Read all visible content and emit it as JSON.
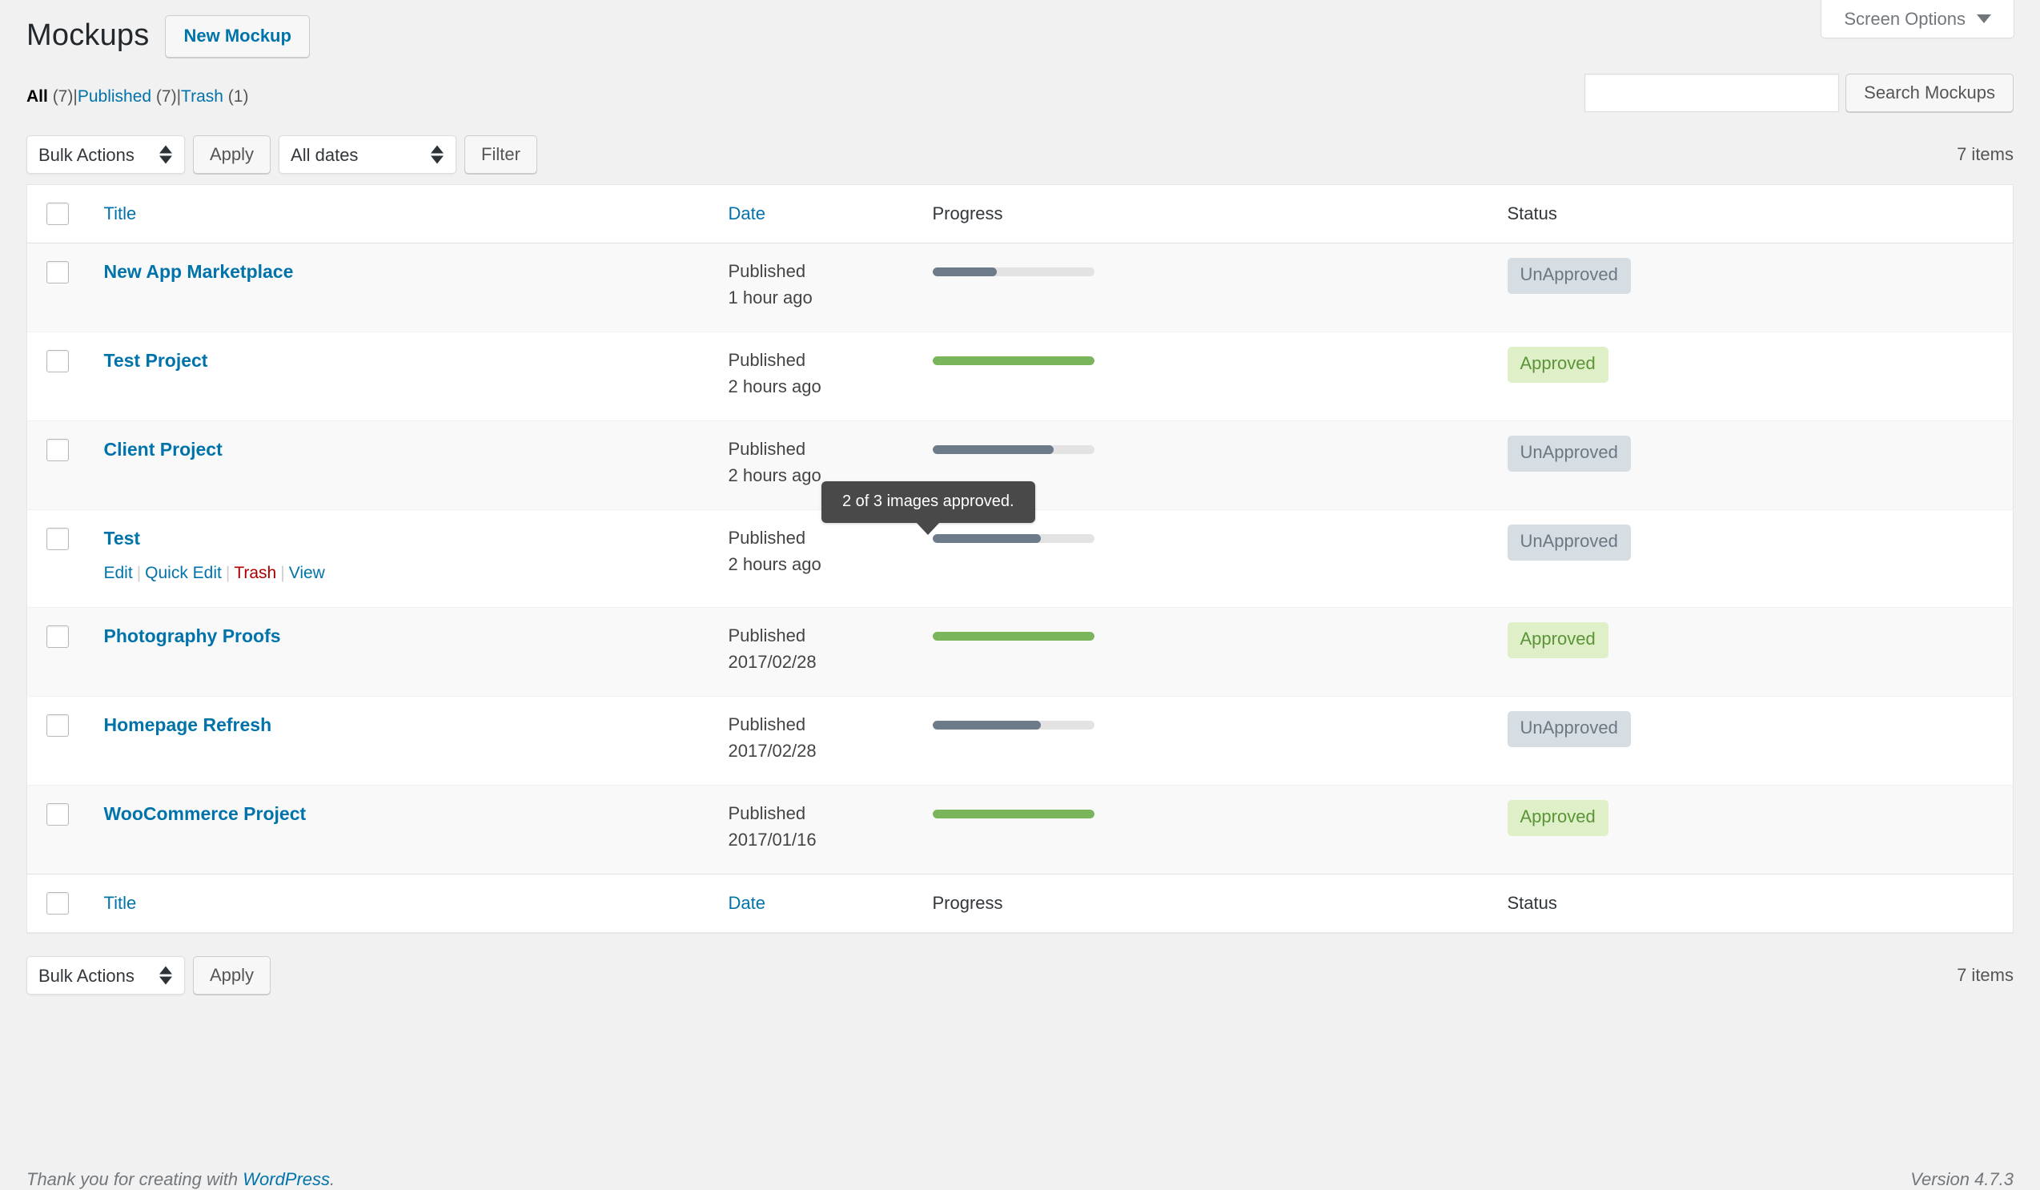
{
  "screen_meta": {
    "screen_options_label": "Screen Options",
    "caret_icon": "chevron-down-icon"
  },
  "header": {
    "title": "Mockups",
    "new_button_label": "New Mockup"
  },
  "search": {
    "value": "",
    "placeholder": "",
    "button_label": "Search Mockups"
  },
  "views": [
    {
      "label": "All",
      "count": "(7)",
      "current": true
    },
    {
      "label": "Published",
      "count": "(7)",
      "current": false
    },
    {
      "label": "Trash",
      "count": "(1)",
      "current": false
    }
  ],
  "view_separator": "|",
  "tablenav_top": {
    "bulk_actions_value": "Bulk Actions",
    "apply_label": "Apply",
    "dates_value": "All dates",
    "filter_label": "Filter",
    "items_count": "7 items"
  },
  "tablenav_bottom": {
    "bulk_actions_value": "Bulk Actions",
    "apply_label": "Apply",
    "items_count": "7 items"
  },
  "table": {
    "columns": {
      "title": "Title",
      "date": "Date",
      "progress": "Progress",
      "status": "Status"
    },
    "rows": [
      {
        "title": "New App Marketplace",
        "date_status": "Published",
        "date_value": "1 hour ago",
        "progress_percent": 40,
        "progress_complete": false,
        "status": "UnApproved"
      },
      {
        "title": "Test Project",
        "date_status": "Published",
        "date_value": "2 hours ago",
        "progress_percent": 100,
        "progress_complete": true,
        "status": "Approved"
      },
      {
        "title": "Client Project",
        "date_status": "Published",
        "date_value": "2 hours ago",
        "progress_percent": 75,
        "progress_complete": false,
        "status": "UnApproved"
      },
      {
        "title": "Test",
        "date_status": "Published",
        "date_value": "2 hours ago",
        "progress_percent": 67,
        "progress_complete": false,
        "status": "UnApproved",
        "actions": {
          "edit": "Edit",
          "quick_edit": "Quick Edit",
          "trash": "Trash",
          "view": "View"
        }
      },
      {
        "title": "Photography Proofs",
        "date_status": "Published",
        "date_value": "2017/02/28",
        "progress_percent": 100,
        "progress_complete": true,
        "status": "Approved"
      },
      {
        "title": "Homepage Refresh",
        "date_status": "Published",
        "date_value": "2017/02/28",
        "progress_percent": 67,
        "progress_complete": false,
        "status": "UnApproved"
      },
      {
        "title": "WooCommerce Project",
        "date_status": "Published",
        "date_value": "2017/01/16",
        "progress_percent": 100,
        "progress_complete": true,
        "status": "Approved"
      }
    ]
  },
  "tooltip": {
    "text": "2 of 3 images approved."
  },
  "footer": {
    "thanks_prefix": "Thank you for creating with ",
    "wordpress_link": "WordPress",
    "thanks_suffix": ".",
    "version": "Version 4.7.3"
  },
  "colors": {
    "link": "#0073aa",
    "trash_link": "#a00",
    "progress_incomplete": "#6c7a89",
    "progress_complete": "#7ab55c",
    "badge_unapproved_bg": "#d6dde3",
    "badge_approved_bg": "#dff0c8",
    "tooltip_bg": "#494949"
  }
}
